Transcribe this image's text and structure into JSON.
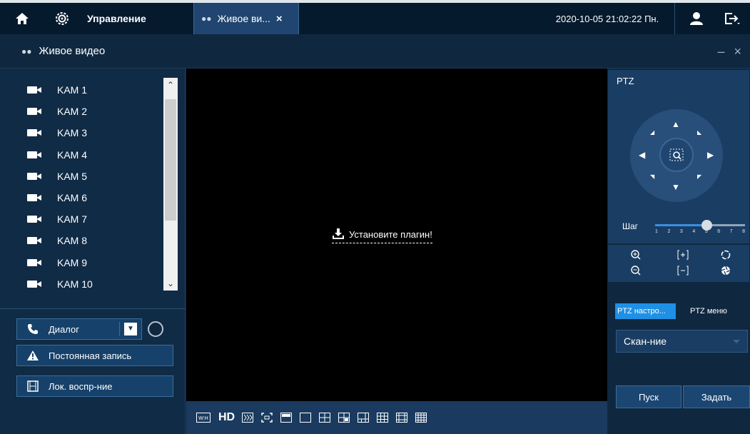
{
  "topbar": {
    "management_label": "Управление",
    "tab_label": "Живое ви...",
    "tab_close": "×",
    "datetime": "2020-10-05 21:02:22 Пн."
  },
  "title": {
    "text": "Живое видео",
    "window_controls": "– ×"
  },
  "cameras": [
    "KAM 1",
    "KAM 2",
    "KAM 3",
    "KAM 4",
    "KAM 5",
    "KAM 6",
    "KAM 7",
    "KAM 8",
    "KAM 9",
    "KAM 10"
  ],
  "actions": {
    "dialog_label": "Диалог",
    "record_label": "Постоянная запись",
    "playback_label": "Лок. воспр-ние"
  },
  "video": {
    "plugin_message": "Установите плагин!"
  },
  "toolbar": {
    "wh_label": "W:H",
    "hd_label": "HD"
  },
  "ptz": {
    "title": "PTZ",
    "step_label": "Шаг",
    "step_ticks": [
      "1",
      "2",
      "3",
      "4",
      "5",
      "6",
      "7",
      "8"
    ],
    "step_value": 5,
    "tab_settings": "PTZ настро...",
    "tab_menu": "PTZ меню",
    "scan_value": "Скан-ние",
    "start_button": "Пуск",
    "set_button": "Задать"
  },
  "colors": {
    "accent": "#1e90e6",
    "panel": "#1a3d63",
    "background": "#0f2840"
  }
}
